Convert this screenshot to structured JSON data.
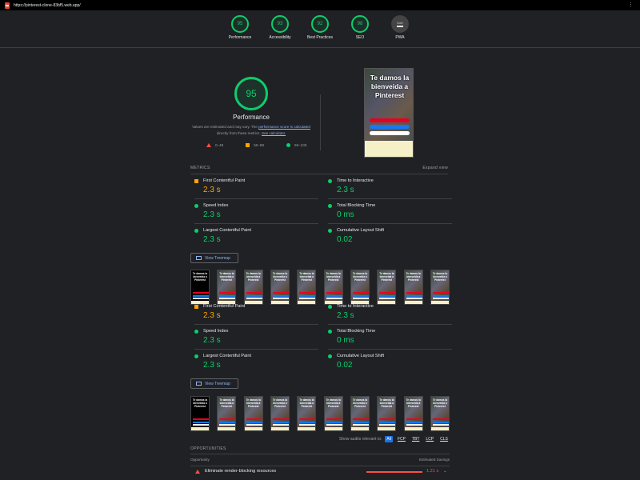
{
  "browser": {
    "url": "https://pinterest-clone-83bf5.web.app/"
  },
  "summary": [
    {
      "score": "95",
      "label": "Performance"
    },
    {
      "score": "93",
      "label": "Accessibility"
    },
    {
      "score": "92",
      "label": "Best Practices"
    },
    {
      "score": "98",
      "label": "SEO"
    }
  ],
  "pwa": {
    "badge": "Both",
    "label": "PWA"
  },
  "performance": {
    "score": "95",
    "title": "Performance",
    "desc_pre": "Values are estimated and may vary. The ",
    "desc_link1": "performance score is calculated",
    "desc_mid": " directly from these metrics. ",
    "desc_link2": "See calculator.",
    "legend": [
      "0–49",
      "50–89",
      "90–100"
    ]
  },
  "screenshot": {
    "heading": "Te damos la bienveida a Pinterest"
  },
  "metrics_section": {
    "title": "METRICS",
    "expand": "Expand view"
  },
  "metrics_block1": [
    {
      "label": "First Contentful Paint",
      "value": "2.3 s"
    },
    {
      "label": "Time to Interactive",
      "value": "2.3 s"
    },
    {
      "label": "Speed Index",
      "value": "2.3 s"
    },
    {
      "label": "Total Blocking Time",
      "value": "0 ms"
    },
    {
      "label": "Largest Contentful Paint",
      "value": "2.3 s"
    },
    {
      "label": "Cumulative Layout Shift",
      "value": "0.02"
    }
  ],
  "metrics_block2": [
    {
      "label": "First Contentful Paint",
      "value": "2.3 s"
    },
    {
      "label": "Time to Interactive",
      "value": "2.3 s"
    },
    {
      "label": "Speed Index",
      "value": "2.3 s"
    },
    {
      "label": "Total Blocking Time",
      "value": "0 ms"
    },
    {
      "label": "Largest Contentful Paint",
      "value": "2.3 s"
    },
    {
      "label": "Cumulative Layout Shift",
      "value": "0.02"
    }
  ],
  "treemap": {
    "label": "View Treemap"
  },
  "thumb_text": "Te damos la bienveida a Pinterest",
  "filter": {
    "label": "Show audits relevant to:",
    "chips": [
      "All",
      "FCP",
      "TBT",
      "LCP",
      "CLS"
    ]
  },
  "opportunities": {
    "title": "OPPORTUNITIES",
    "col1": "Opportunity",
    "col2": "Estimated Savings",
    "row_label": "Eliminate render-blocking resources",
    "row_value": "1.21 s"
  },
  "colors": {
    "pass": "#0cce6b",
    "average": "#ffa400",
    "fail": "#ff4e42",
    "link": "#8ab4f8"
  }
}
